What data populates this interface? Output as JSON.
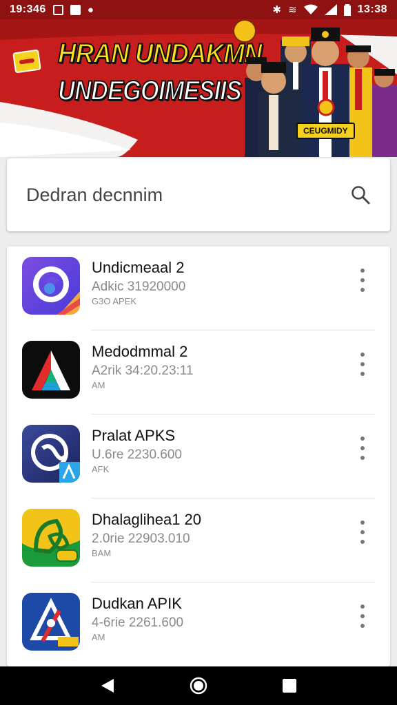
{
  "status_bar": {
    "left_time": "19:346",
    "right_time": "13:38"
  },
  "banner": {
    "title_line1": "HRAN UNDAKMN",
    "title_line2": "UNDEGOIMESIIS",
    "badge": "CEUGMIDY"
  },
  "search": {
    "text": "Dedran decnnim"
  },
  "apps": [
    {
      "name": "Undicmeaal 2",
      "line1": "Adkic 31920000",
      "line2": "G3O APEK",
      "icon": "swirl-app-icon",
      "color": "#6a4de0"
    },
    {
      "name": "Medodmmal 2",
      "line1": "A2rik 34:20.23:11",
      "line2": "AM",
      "icon": "triangle-app-icon",
      "color": "#111111"
    },
    {
      "name": "Pralat APKS",
      "line1": "U.6re 2230.600",
      "line2": "AFK",
      "icon": "circle-link-app-icon",
      "color": "#2a3a80"
    },
    {
      "name": "Dhalaglihea1 20",
      "line1": "2.0rie 22903.010",
      "line2": "BAM",
      "icon": "leaf-app-icon",
      "color": "#f2c41a"
    },
    {
      "name": "Dudkan APIK",
      "line1": "4-6rie 2261.600",
      "line2": "AM",
      "icon": "compass-app-icon",
      "color": "#1d4aa6"
    }
  ],
  "nav": {
    "back": "back-icon",
    "home": "home-icon",
    "recents": "recents-icon"
  }
}
